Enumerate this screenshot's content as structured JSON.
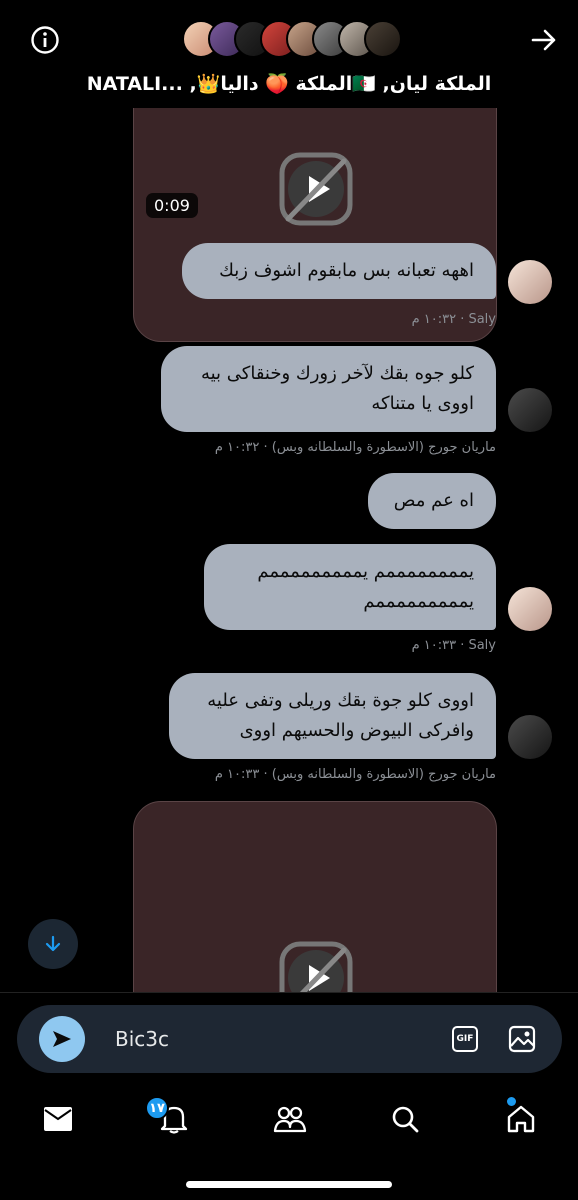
{
  "header": {
    "title": "NATALI... ,👑الملكة 🍑 داليا🇩🇿 ,الملكة ليان",
    "info_icon": "info-circle-icon",
    "forward_icon": "arrow-right-icon"
  },
  "messages": [
    {
      "type": "video",
      "duration": "0:09"
    },
    {
      "type": "text",
      "text": "اههه تعبانه بس مابقوم اشوف زبك",
      "meta": "Saly · ١٠:٣٢ م"
    },
    {
      "type": "text",
      "text": "كلو جوه بقك لآخر زورك وخنقاكى بيه اووى يا متناكه",
      "meta": "ماريان جورج (الاسطورة والسلطانه وبس) · ١٠:٣٢ م"
    },
    {
      "type": "text",
      "text": "اه عم مص"
    },
    {
      "type": "text",
      "text": "يممممممممم يمممممممممم يمممممممممم",
      "meta": "Saly · ١٠:٣٣ م"
    },
    {
      "type": "text",
      "text": "اووى كلو جوة بقك وريلى وتفى عليه وافركى البيوض والحسيهم اووى",
      "meta": "ماريان جورج (الاسطورة والسلطانه وبس) · ١٠:٣٣ م"
    },
    {
      "type": "video"
    }
  ],
  "composer": {
    "value": "Bic3c",
    "send_icon": "send-icon",
    "gif_label": "GIF",
    "image_icon": "image-icon"
  },
  "nav": {
    "items": [
      "mail-icon",
      "bell-icon",
      "people-icon",
      "search-icon",
      "home-icon"
    ],
    "notification_badge": "١٧"
  },
  "colors": {
    "bubble": "#a9b1bd",
    "accent": "#1d9bf0",
    "send": "#8fc8f0",
    "composer": "#1e2733",
    "video": "#3a2527"
  }
}
